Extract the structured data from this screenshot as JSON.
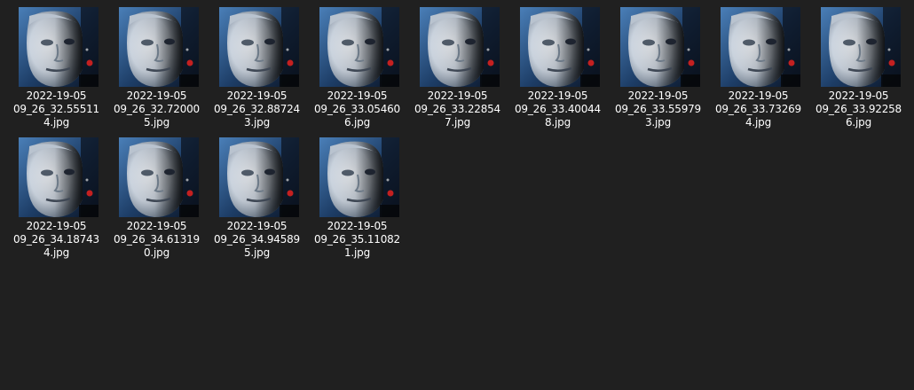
{
  "files": [
    {
      "name_lines": [
        "2022-19-05",
        "09_26_32.55511",
        "4.jpg"
      ],
      "thumbnail_icon": "face-photo-icon"
    },
    {
      "name_lines": [
        "2022-19-05",
        "09_26_32.72000",
        "5.jpg"
      ],
      "thumbnail_icon": "face-photo-icon"
    },
    {
      "name_lines": [
        "2022-19-05",
        "09_26_32.88724",
        "3.jpg"
      ],
      "thumbnail_icon": "face-photo-icon"
    },
    {
      "name_lines": [
        "2022-19-05",
        "09_26_33.05460",
        "6.jpg"
      ],
      "thumbnail_icon": "face-photo-icon"
    },
    {
      "name_lines": [
        "2022-19-05",
        "09_26_33.22854",
        "7.jpg"
      ],
      "thumbnail_icon": "face-photo-icon"
    },
    {
      "name_lines": [
        "2022-19-05",
        "09_26_33.40044",
        "8.jpg"
      ],
      "thumbnail_icon": "face-photo-icon"
    },
    {
      "name_lines": [
        "2022-19-05",
        "09_26_33.55979",
        "3.jpg"
      ],
      "thumbnail_icon": "face-photo-icon"
    },
    {
      "name_lines": [
        "2022-19-05",
        "09_26_33.73269",
        "4.jpg"
      ],
      "thumbnail_icon": "face-photo-icon"
    },
    {
      "name_lines": [
        "2022-19-05",
        "09_26_33.92258",
        "6.jpg"
      ],
      "thumbnail_icon": "face-photo-icon"
    },
    {
      "name_lines": [
        "2022-19-05",
        "09_26_34.18743",
        "4.jpg"
      ],
      "thumbnail_icon": "face-photo-icon"
    },
    {
      "name_lines": [
        "2022-19-05",
        "09_26_34.61319",
        "0.jpg"
      ],
      "thumbnail_icon": "face-photo-icon"
    },
    {
      "name_lines": [
        "2022-19-05",
        "09_26_34.94589",
        "5.jpg"
      ],
      "thumbnail_icon": "face-photo-icon"
    },
    {
      "name_lines": [
        "2022-19-05",
        "09_26_35.11082",
        "1.jpg"
      ],
      "thumbnail_icon": "face-photo-icon"
    }
  ],
  "colors": {
    "background": "#202020",
    "label_text": "#ffffff"
  }
}
